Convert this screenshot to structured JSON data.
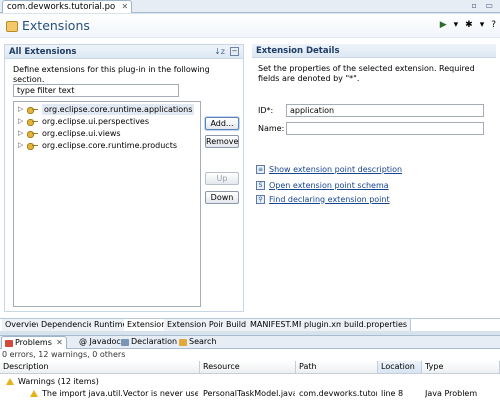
{
  "editor": {
    "tab_title": "com.devworks.tutorial.po",
    "tab_close": "✕",
    "window_controls": "▫ ▭"
  },
  "form": {
    "title": "Extensions",
    "header_tools": [
      "▶",
      "▾",
      "✱",
      "▾",
      "?"
    ],
    "left_section": {
      "title": "All Extensions",
      "sort_icon_text": "↓z",
      "collapse_icon_text": "−",
      "description": "Define extensions for this plug-in in the following section.",
      "filter_value": "type filter text",
      "tree": [
        {
          "label": "org.eclipse.core.runtime.applications",
          "selected": true
        },
        {
          "label": "org.eclipse.ui.perspectives",
          "selected": false
        },
        {
          "label": "org.eclipse.ui.views",
          "selected": false
        },
        {
          "label": "org.eclipse.core.runtime.products",
          "selected": false
        }
      ],
      "buttons": {
        "add": "Add...",
        "remove": "Remove",
        "up": "Up",
        "down": "Down"
      }
    },
    "right_section": {
      "title": "Extension Details",
      "description": "Set the properties of the selected extension. Required fields are denoted by \"*\".",
      "id_label": "ID*:",
      "id_value": "application",
      "name_label": "Name:",
      "name_value": "",
      "links": [
        "Show extension point description",
        "Open extension point schema",
        "Find declaring extension point"
      ]
    },
    "page_tabs": [
      "Overview",
      "Dependencies",
      "Runtime",
      "Extensions",
      "Extension Points",
      "Build",
      "MANIFEST.MF",
      "plugin.xml",
      "build.properties"
    ],
    "active_page_tab": "Extensions"
  },
  "views": {
    "tabs": [
      "Problems",
      "@ Javadoc",
      "Declaration",
      "Search"
    ],
    "summary": "0 errors, 12 warnings, 0 others",
    "columns": [
      "Description",
      "Resource",
      "Path",
      "Location",
      "Type"
    ],
    "group_label": "Warnings (12 items)",
    "rows": [
      {
        "description": "The import java.util.Vector is never used",
        "resource": "PersonalTaskModel.java",
        "path": "com.devworks.tutori...",
        "location": "line 8",
        "type": "Java Problem"
      }
    ]
  },
  "colors": {
    "accent": "#274f7f",
    "link": "#16448f",
    "warning": "#e6b21c"
  }
}
